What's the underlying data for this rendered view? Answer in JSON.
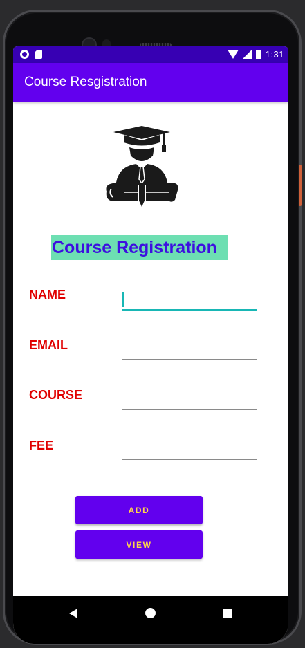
{
  "status_bar": {
    "time": "1:31"
  },
  "app_bar": {
    "title": "Course Resgistration"
  },
  "form": {
    "title": "Course Registration",
    "fields": [
      {
        "label": "NAME",
        "value": ""
      },
      {
        "label": "EMAIL",
        "value": ""
      },
      {
        "label": "COURSE",
        "value": ""
      },
      {
        "label": "FEE",
        "value": ""
      }
    ]
  },
  "buttons": {
    "add_label": "ADD",
    "view_label": "VIEW"
  },
  "colors": {
    "app_bar": "#6200ee",
    "status_bar": "#3700b3",
    "title_background": "#6ddfb2",
    "title_text": "#3d0fe0",
    "label_text": "#e00000",
    "button_text": "#ffd54a",
    "input_focus": "#18b7b5"
  },
  "icons": {
    "status_left": [
      "sync-circle-icon",
      "sim-card-icon"
    ],
    "status_right": [
      "wifi-icon",
      "signal-icon",
      "battery-icon"
    ],
    "logo": "graduate-with-diploma-icon",
    "nav": [
      "back-icon",
      "home-icon",
      "recent-apps-icon"
    ]
  }
}
